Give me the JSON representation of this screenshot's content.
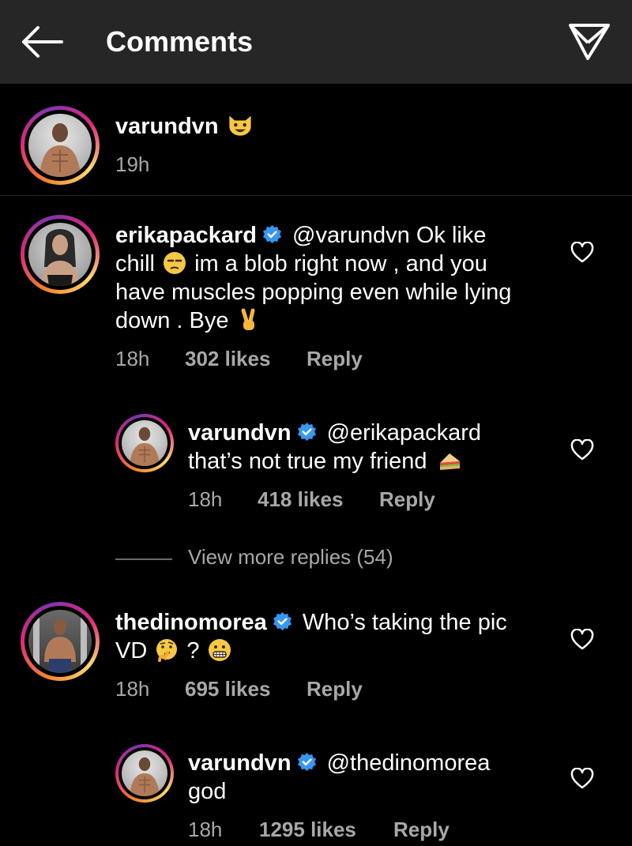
{
  "header": {
    "title": "Comments",
    "back_icon": "arrow-left-icon",
    "send_icon": "direct-send-icon"
  },
  "caption": {
    "username": "varundvn",
    "emoji": "grinning-cat-emoji",
    "time": "19h"
  },
  "comments": [
    {
      "username": "erikapackard",
      "verified": true,
      "text_line1": "@varundvn Ok like",
      "text_line2_a": "chill",
      "emoji1": "unamused-face-emoji",
      "text_line2_b": "im a blob right now , and you",
      "text_line3": "have muscles popping even while lying",
      "text_line4": "down . Bye",
      "emoji2": "victory-hand-emoji",
      "time": "18h",
      "likes": "302 likes",
      "reply": "Reply"
    },
    {
      "username": "varundvn",
      "verified": true,
      "text_line1": "@erikapackard",
      "text_line2": "that’s not true my friend",
      "emoji1": "sandwich-emoji",
      "time": "18h",
      "likes": "418 likes",
      "reply": "Reply"
    },
    {
      "username": "thedinomorea",
      "verified": true,
      "text_line1": "Who’s taking the pic",
      "text_line2_a": "VD",
      "emoji1": "thinking-face-emoji",
      "text_line2_b": "?",
      "emoji2": "grimacing-face-emoji",
      "time": "18h",
      "likes": "695 likes",
      "reply": "Reply"
    },
    {
      "username": "varundvn",
      "verified": true,
      "text_line1": "@thedinomorea",
      "text_line2": "god",
      "time": "18h",
      "likes": "1295 likes",
      "reply": "Reply"
    }
  ],
  "view_more": "View more replies (54)",
  "colors": {
    "background": "#000000",
    "header": "#262626",
    "secondary_text": "#a8a8a8",
    "verified_blue": "#3897f0"
  }
}
